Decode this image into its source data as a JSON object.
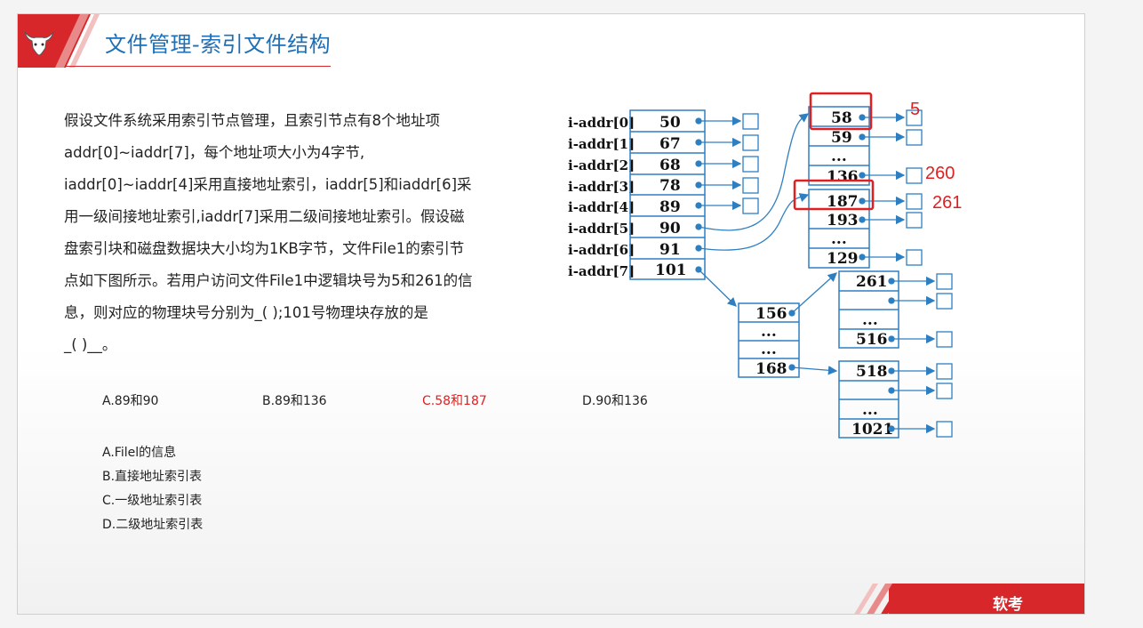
{
  "header": {
    "title": "文件管理-索引文件结构"
  },
  "question": {
    "lines": [
      "假设文件系统采用索引节点管理，且索引节点有8个地址项",
      "addr[0]~iaddr[7]，每个地址项大小为4字节,",
      "iaddr[0]~iaddr[4]采用直接地址索引，iaddr[5]和iaddr[6]采",
      "用一级间接地址索引,iaddr[7]采用二级间接地址索引。假设磁",
      "盘索引块和磁盘数据块大小均为1KB字节，文件File1的索引节",
      "点如下图所示。若用户访问文件File1中逻辑块号为5和261的信",
      "息，则对应的物理块号分别为_(  );101号物理块存放的是",
      "_( )__。"
    ]
  },
  "options1": [
    {
      "label": "A.89和90",
      "correct": false
    },
    {
      "label": "B.89和136",
      "correct": false
    },
    {
      "label": "C.58和187",
      "correct": true
    },
    {
      "label": "D.90和136",
      "correct": false
    }
  ],
  "options2": [
    {
      "label": "A.Filel的信息",
      "correct": false
    },
    {
      "label": "B.直接地址索引表",
      "correct": false
    },
    {
      "label": "C.一级地址索引表",
      "correct": false
    },
    {
      "label": "D.二级地址索引表",
      "correct": true
    }
  ],
  "diagram": {
    "inode_labels": [
      "i-addr[0]",
      "i-addr[1]",
      "i-addr[2]",
      "i-addr[3]",
      "i-addr[4]",
      "i-addr[5]",
      "i-addr[6]",
      "i-addr[7]"
    ],
    "inode_values": [
      "50",
      "67",
      "68",
      "78",
      "89",
      "90",
      "91",
      "101"
    ],
    "block_a": [
      "58",
      "59",
      "...",
      "136"
    ],
    "block_b": [
      "187",
      "193",
      "...",
      "129"
    ],
    "block_c": [
      "156",
      "...",
      "...",
      "168"
    ],
    "block_d": [
      "261",
      "",
      "...",
      "516"
    ],
    "block_e": [
      "518",
      "",
      "...",
      "1021"
    ],
    "annotations": [
      "5",
      "260",
      "261"
    ]
  },
  "footer": {
    "label": "软考"
  },
  "colors": {
    "accent_red": "#d7272b",
    "title_blue": "#1f6fb5",
    "diagram_blue": "#2e7fc2",
    "answer_red": "#e02020"
  }
}
